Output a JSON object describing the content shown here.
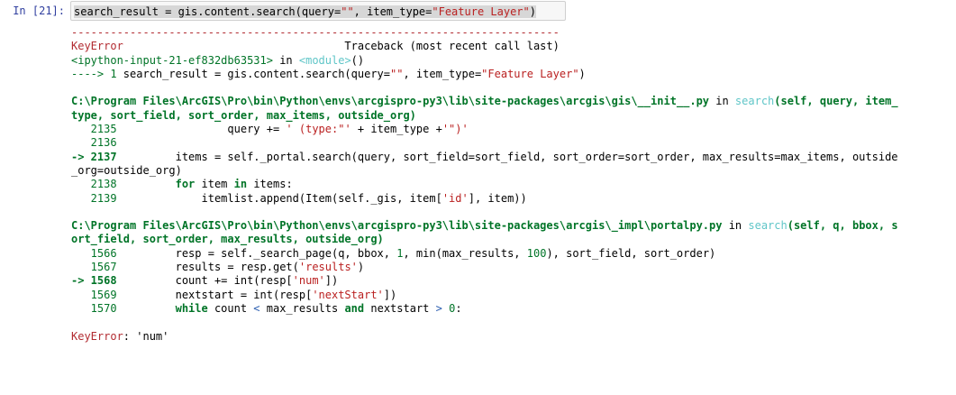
{
  "cell": {
    "prompt": "In [21]:",
    "input_prefix": "search_result = gis.content.search(query=",
    "input_str1": "\"\"",
    "input_mid": ", item_type=",
    "input_str2": "\"Feature Layer\"",
    "input_suffix": ")"
  },
  "traceback": {
    "separator": "---------------------------------------------------------------------------",
    "error_name": "KeyError",
    "traceback_label": "                                  Traceback (most recent call last)",
    "frame0_file": "<ipython-input-21-ef832db63531>",
    "frame0_in": " in ",
    "frame0_func": "<module>",
    "frame0_paren": "()",
    "frame0_arrow": "----> 1 ",
    "frame0_code_a": "search_result = gis.content.search(query=",
    "frame0_code_s1": "\"\"",
    "frame0_code_b": ", item_type=",
    "frame0_code_s2": "\"Feature Layer\"",
    "frame0_code_c": ")",
    "frame1_file": "C:\\Program Files\\ArcGIS\\Pro\\bin\\Python\\envs\\arcgispro-py3\\lib\\site-packages\\arcgis\\gis\\__init__.py",
    "frame1_in": " in ",
    "frame1_func": "search",
    "frame1_sig1": "(self, query, item_",
    "frame1_sig2": "type, sort_field, sort_order, max_items, outside_org)",
    "f1_l2135_no": "   2135 ",
    "f1_l2135_a": "                query += ",
    "f1_l2135_s1": "' (type:\"'",
    "f1_l2135_b": " + item_type +",
    "f1_l2135_s2": "'\")'",
    "f1_l2136_no": "   2136 ",
    "f1_l2137_no": "-> 2137 ",
    "f1_l2137_code": "        items = self._portal.search(query, sort_field=sort_field, sort_order=sort_order, max_results=max_items, outside",
    "f1_l2137_wrap": "_org=outside_org)",
    "f1_l2138_no": "   2138 ",
    "f1_l2138_a": "        ",
    "f1_l2138_kw1": "for",
    "f1_l2138_b": " item ",
    "f1_l2138_kw2": "in",
    "f1_l2138_c": " items:",
    "f1_l2139_no": "   2139 ",
    "f1_l2139_a": "            itemlist.append(Item(self._gis, item[",
    "f1_l2139_s": "'id'",
    "f1_l2139_b": "], item))",
    "frame2_file": "C:\\Program Files\\ArcGIS\\Pro\\bin\\Python\\envs\\arcgispro-py3\\lib\\site-packages\\arcgis\\_impl\\portalpy.py",
    "frame2_in": " in ",
    "frame2_func": "search",
    "frame2_sig1": "(self, q, bbox, s",
    "frame2_sig2": "ort_field, sort_order, max_results, outside_org)",
    "f2_l1566_no": "   1566 ",
    "f2_l1566_a": "        resp = self._search_page(q, bbox, ",
    "f2_l1566_n1": "1",
    "f2_l1566_b": ", min(max_results, ",
    "f2_l1566_n2": "100",
    "f2_l1566_c": "), sort_field, sort_order)",
    "f2_l1567_no": "   1567 ",
    "f2_l1567_a": "        results = resp.get(",
    "f2_l1567_s": "'results'",
    "f2_l1567_b": ")",
    "f2_l1568_no": "-> 1568 ",
    "f2_l1568_a": "        count += int(resp[",
    "f2_l1568_s": "'num'",
    "f2_l1568_b": "])",
    "f2_l1569_no": "   1569 ",
    "f2_l1569_a": "        nextstart = int(resp[",
    "f2_l1569_s": "'nextStart'",
    "f2_l1569_b": "])",
    "f2_l1570_no": "   1570 ",
    "f2_l1570_a": "        ",
    "f2_l1570_kw1": "while",
    "f2_l1570_b": " count ",
    "f2_l1570_op1": "<",
    "f2_l1570_c": " max_results ",
    "f2_l1570_kw2": "and",
    "f2_l1570_d": " nextstart ",
    "f2_l1570_op2": ">",
    "f2_l1570_e": " ",
    "f2_l1570_n": "0",
    "f2_l1570_f": ":",
    "final_error_name": "KeyError",
    "final_error_msg": ": 'num'"
  }
}
